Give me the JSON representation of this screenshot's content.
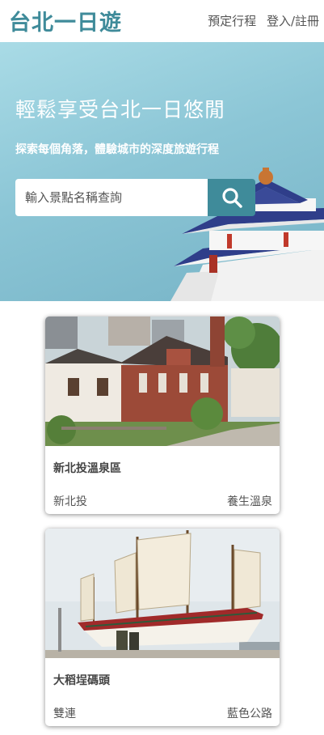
{
  "header": {
    "logo": "台北一日遊",
    "nav": [
      "預定行程",
      "登入/註冊"
    ]
  },
  "hero": {
    "title": "輕鬆享受台北一日悠閒",
    "subtitle": "探索每個角落，體驗城市的深度旅遊行程",
    "search_placeholder": "輸入景點名稱查詢",
    "search_icon": "search-icon"
  },
  "cards": [
    {
      "title": "新北投溫泉區",
      "location": "新北投",
      "category": "養生溫泉"
    },
    {
      "title": "大稻埕碼頭",
      "location": "雙連",
      "category": "藍色公路"
    }
  ],
  "colors": {
    "brand": "#3f8b9a",
    "hero_gradient_start": "#a9dbe6",
    "hero_gradient_end": "#76b3c6"
  }
}
